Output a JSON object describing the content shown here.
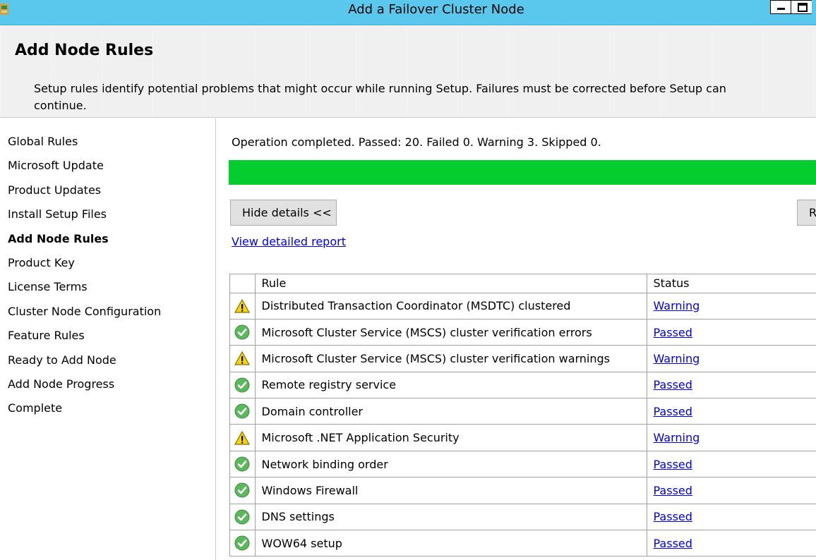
{
  "window": {
    "title": "Add a Failover Cluster Node"
  },
  "header": {
    "heading": "Add Node Rules",
    "description": "Setup rules identify potential problems that might occur while running Setup. Failures must be corrected before Setup can continue."
  },
  "nav": {
    "items": [
      {
        "label": "Global Rules"
      },
      {
        "label": "Microsoft Update"
      },
      {
        "label": "Product Updates"
      },
      {
        "label": "Install Setup Files"
      },
      {
        "label": "Add Node Rules",
        "current": true
      },
      {
        "label": "Product Key"
      },
      {
        "label": "License Terms"
      },
      {
        "label": "Cluster Node Configuration"
      },
      {
        "label": "Feature Rules"
      },
      {
        "label": "Ready to Add Node"
      },
      {
        "label": "Add Node Progress"
      },
      {
        "label": "Complete"
      }
    ]
  },
  "main": {
    "operation_status": "Operation completed. Passed: 20.   Failed 0.   Warning 3.   Skipped 0.",
    "progress_percent": 100,
    "progress_color": "#06cd2f",
    "hide_details_label": "Hide details <<",
    "rerun_label": "R",
    "report_link": "View detailed report",
    "columns": [
      "",
      "Rule",
      "Status"
    ],
    "rules": [
      {
        "icon": "warning-icon",
        "rule": "Distributed Transaction Coordinator (MSDTC) clustered",
        "status": "Warning"
      },
      {
        "icon": "check-icon",
        "rule": "Microsoft Cluster Service (MSCS) cluster verification errors",
        "status": "Passed"
      },
      {
        "icon": "warning-icon",
        "rule": "Microsoft Cluster Service (MSCS) cluster verification warnings",
        "status": "Warning"
      },
      {
        "icon": "check-icon",
        "rule": "Remote registry service",
        "status": "Passed"
      },
      {
        "icon": "check-icon",
        "rule": "Domain controller",
        "status": "Passed"
      },
      {
        "icon": "warning-icon",
        "rule": "Microsoft .NET Application Security",
        "status": "Warning"
      },
      {
        "icon": "check-icon",
        "rule": "Network binding order",
        "status": "Passed"
      },
      {
        "icon": "check-icon",
        "rule": "Windows Firewall",
        "status": "Passed"
      },
      {
        "icon": "check-icon",
        "rule": "DNS settings",
        "status": "Passed"
      },
      {
        "icon": "check-icon",
        "rule": "WOW64 setup",
        "status": "Passed"
      }
    ]
  }
}
